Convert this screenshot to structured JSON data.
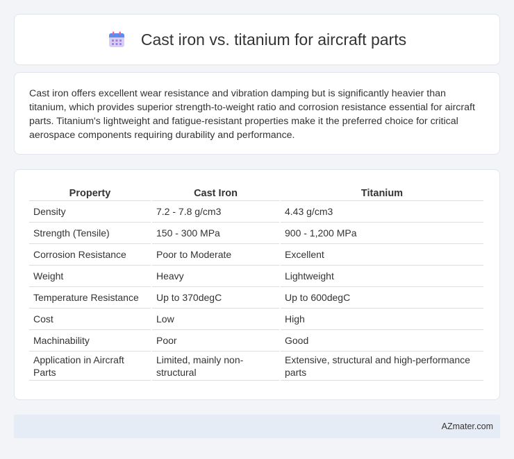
{
  "header": {
    "icon": "calendar-icon",
    "title": "Cast iron vs. titanium for aircraft parts"
  },
  "summary": {
    "text": "Cast iron offers excellent wear resistance and vibration damping but is significantly heavier than titanium, which provides superior strength-to-weight ratio and corrosion resistance essential for aircraft parts. Titanium's lightweight and fatigue-resistant properties make it the preferred choice for critical aerospace components requiring durability and performance."
  },
  "table": {
    "headers": [
      "Property",
      "Cast Iron",
      "Titanium"
    ],
    "rows": [
      [
        "Density",
        "7.2 - 7.8 g/cm3",
        "4.43 g/cm3"
      ],
      [
        "Strength (Tensile)",
        "150 - 300 MPa",
        "900 - 1,200 MPa"
      ],
      [
        "Corrosion Resistance",
        "Poor to Moderate",
        "Excellent"
      ],
      [
        "Weight",
        "Heavy",
        "Lightweight"
      ],
      [
        "Temperature Resistance",
        "Up to 370degC",
        "Up to 600degC"
      ],
      [
        "Cost",
        "Low",
        "High"
      ],
      [
        "Machinability",
        "Poor",
        "Good"
      ],
      [
        "Application in Aircraft Parts",
        "Limited, mainly non-structural",
        "Extensive, structural and high-performance parts"
      ]
    ]
  },
  "footer": {
    "text": "AZmater.com"
  },
  "colors": {
    "background": "#f2f4f8",
    "card": "#ffffff",
    "footer_bg": "#e6ecf5",
    "icon_top": "#5b8def",
    "icon_body": "#c9b8f0"
  }
}
